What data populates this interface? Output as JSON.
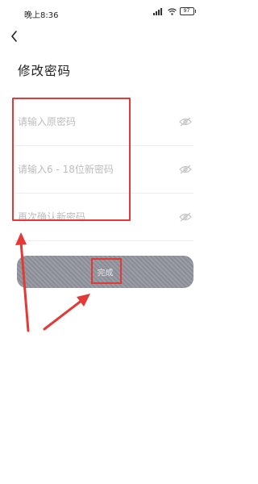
{
  "status_bar": {
    "time": "晚上8:36",
    "battery": "97"
  },
  "header": {
    "title": "修改密码"
  },
  "form": {
    "fields": [
      {
        "placeholder": "请输入原密码",
        "value": ""
      },
      {
        "placeholder": "请输入6 - 18位新密码",
        "value": ""
      },
      {
        "placeholder": "再次确认新密码",
        "value": ""
      }
    ],
    "submit_label": "完成"
  },
  "annotation": {
    "color": "#e53935"
  },
  "icons": [
    "back-arrow-icon",
    "eye-hidden-icon",
    "signal-icon",
    "wifi-icon",
    "battery-icon"
  ]
}
